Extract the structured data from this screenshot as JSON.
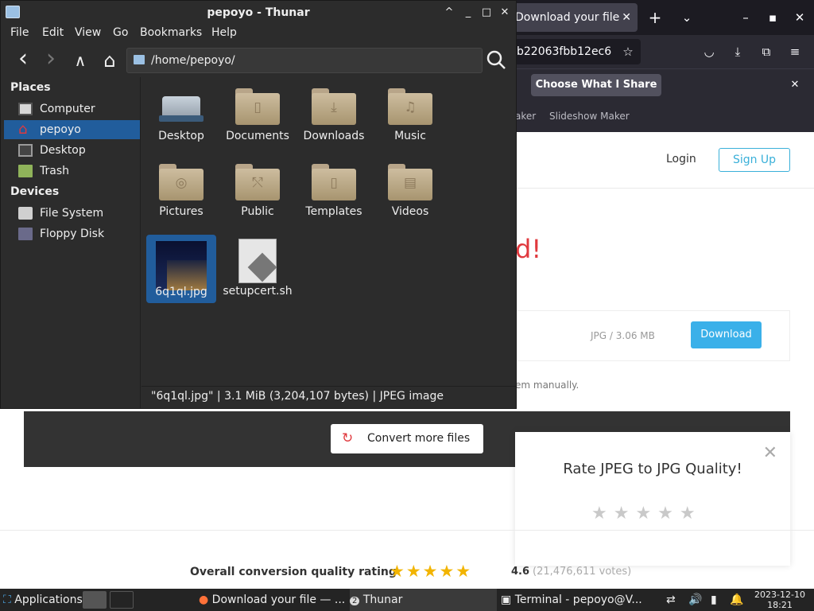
{
  "browser": {
    "tab_title": "Download your file",
    "tab_close": "✕",
    "new_tab": "+",
    "tab_list": "⌄",
    "win_min": "–",
    "win_max": "▪",
    "win_close": "✕",
    "url_fragment": "b22063fbb12ec6",
    "notification_button": "Choose What I Share",
    "notification_close": "✕",
    "bookmarks": [
      "aker",
      "Slideshow Maker"
    ]
  },
  "page": {
    "login": "Login",
    "signup": "Sign Up",
    "headline_tail": "d!",
    "file_info": "JPG / 3.06 MB",
    "download_button": "Download",
    "manual_text": "em manually.",
    "convert_more": "Convert more files",
    "convert_icon": "↻",
    "rate_title": "Rate JPEG to JPG Quality!",
    "rate_close": "✕",
    "rate_stars": "★★★★★",
    "overall_label": "Overall conversion quality rating",
    "overall_stars": "★★★★★",
    "overall_rating": 4.6,
    "overall_score": "4.6",
    "overall_votes": "(21,476,611 votes)"
  },
  "thunar": {
    "title": "pepoyo - Thunar",
    "win_min": "^",
    "win_close_min": "_",
    "win_max": "□",
    "win_close": "✕",
    "menu": [
      "File",
      "Edit",
      "View",
      "Go",
      "Bookmarks",
      "Help"
    ],
    "path": "/home/pepoyo/",
    "back_icon": "‹",
    "forward_icon": "›",
    "up_icon": "∧",
    "home_icon": "⌂",
    "sidebar": {
      "places_heading": "Places",
      "places": [
        "Computer",
        "pepoyo",
        "Desktop",
        "Trash"
      ],
      "devices_heading": "Devices",
      "devices": [
        "File System",
        "Floppy Disk"
      ]
    },
    "files": [
      {
        "name": "Desktop"
      },
      {
        "name": "Documents"
      },
      {
        "name": "Downloads"
      },
      {
        "name": "Music"
      },
      {
        "name": "Pictures"
      },
      {
        "name": "Public"
      },
      {
        "name": "Templates"
      },
      {
        "name": "Videos"
      },
      {
        "name": "6q1ql.jpg"
      },
      {
        "name": "setupcert.sh"
      }
    ],
    "status": "\"6q1ql.jpg\"  |  3.1 MiB (3,204,107 bytes)  |  JPEG image"
  },
  "taskbar": {
    "applications": "Applications",
    "items": [
      "Download your file — ...",
      "Thunar",
      "Terminal - pepoyo@V..."
    ],
    "thunar_count": "2",
    "date": "2023-12-10",
    "time": "18:21"
  },
  "colors": {
    "accent_blue": "#3ab0e9",
    "selection": "#215d9c",
    "headline_red": "#e0393e",
    "star_gold": "#f2b400"
  }
}
